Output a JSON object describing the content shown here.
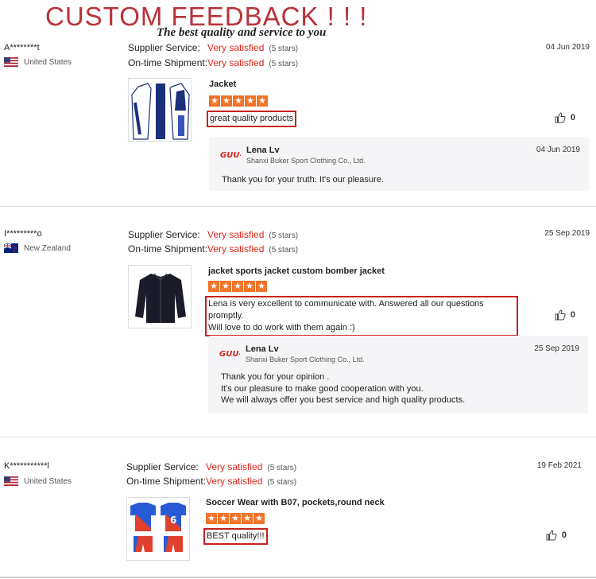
{
  "header": {
    "title": "CUSTOM FEEDBACK  ! ! !",
    "subtitle": "The best quality and service to you"
  },
  "labels": {
    "supplier_service": "Supplier Service:",
    "on_time_shipment": "On-time Shipment:"
  },
  "reviews": [
    {
      "buyer": "A********t",
      "country": "United States",
      "flag": "us-flag-icon",
      "supplier_service": "Very satisfied",
      "supplier_stars": "(5 stars)",
      "shipment": "Very satisfied",
      "shipment_stars": "(5 stars)",
      "date": "04 Jun 2019",
      "product": "Jacket",
      "rating": 5,
      "comment": "great quality products",
      "likes": "0",
      "reply": {
        "seller": "Lena Lv",
        "company": "Shanxi Buker Sport Clothing Co., Ltd.",
        "date": "04 Jun 2019",
        "lines": [
          "Thank you for your truth. It's our pleasure."
        ]
      }
    },
    {
      "buyer": "I*********o",
      "country": "New Zealand",
      "flag": "nz-flag-icon",
      "supplier_service": "Very satisfied",
      "supplier_stars": "(5 stars)",
      "shipment": "Very satisfied",
      "shipment_stars": "(5 stars)",
      "date": "25 Sep 2019",
      "product": "jacket sports jacket custom bomber jacket",
      "rating": 5,
      "comment_lines": [
        "Lena is very excellent to communicate with. Answered all our questions promptly.",
        "Will love to do work with them again :)"
      ],
      "likes": "0",
      "reply": {
        "seller": "Lena Lv",
        "company": "Shanxi Buker Sport Clothing Co., Ltd.",
        "date": "25 Sep 2019",
        "lines": [
          "Thank you for your opinion .",
          "It's our pleasure to make good cooperation with you.",
          "We will always offer you best service and high quality products."
        ]
      }
    },
    {
      "buyer": "K***********l",
      "country": "United States",
      "flag": "us-flag-icon",
      "supplier_service": "Very satisfied",
      "supplier_stars": "(5 stars)",
      "shipment": "Very satisfied",
      "shipment_stars": "(5 stars)",
      "date": "19 Feb 2021",
      "product": "Soccer Wear with B07, pockets,round neck",
      "rating": 5,
      "comment": "BEST quality!!!",
      "likes": "0"
    }
  ],
  "brand_logo_text": "GUU-KR",
  "colors": {
    "title_red": "#b8323a",
    "satisfied_red": "#e0261b",
    "star_orange": "#f0742a",
    "highlight_box": "#c8201e"
  }
}
